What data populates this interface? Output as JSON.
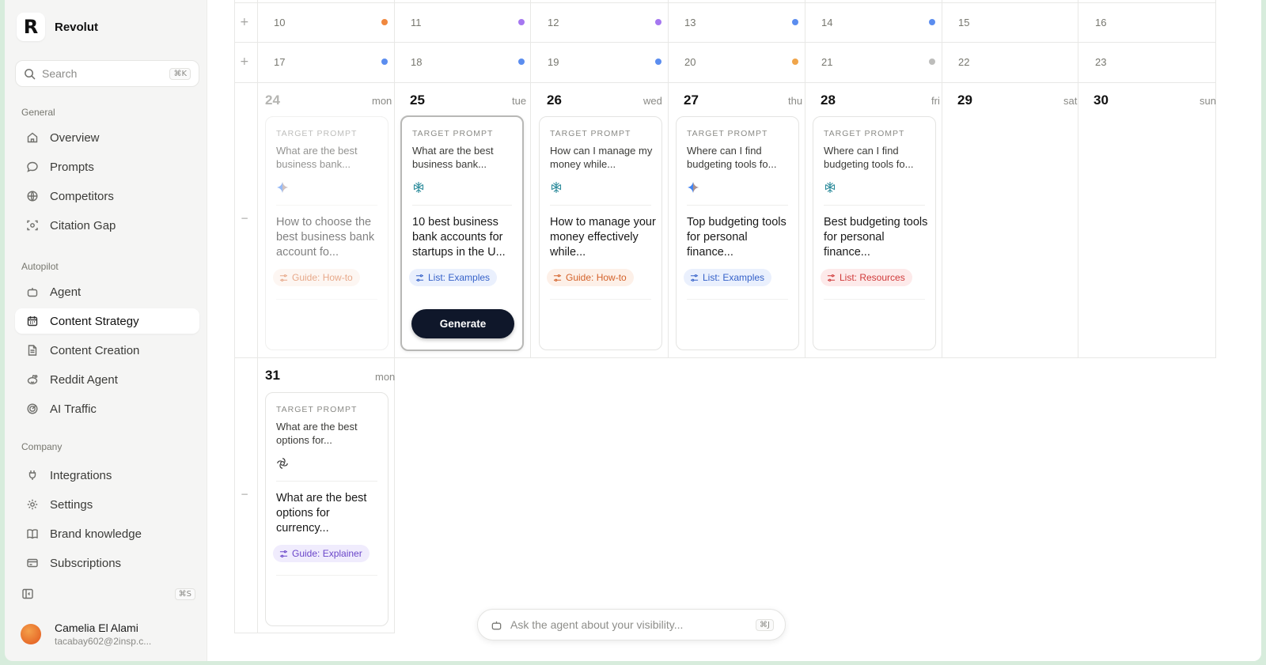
{
  "brand": {
    "logo_letter": "R",
    "name": "Revolut"
  },
  "search": {
    "placeholder": "Search",
    "shortcut": "⌘K"
  },
  "sidebar": {
    "sections": [
      {
        "label": "General",
        "items": [
          {
            "label": "Overview",
            "icon": "home-icon"
          },
          {
            "label": "Prompts",
            "icon": "chat-bubble-icon"
          },
          {
            "label": "Competitors",
            "icon": "globe-icon"
          },
          {
            "label": "Citation Gap",
            "icon": "scan-icon"
          }
        ]
      },
      {
        "label": "Autopilot",
        "items": [
          {
            "label": "Agent",
            "icon": "robot-icon"
          },
          {
            "label": "Content Strategy",
            "icon": "calendar-icon",
            "active": true
          },
          {
            "label": "Content Creation",
            "icon": "document-icon"
          },
          {
            "label": "Reddit Agent",
            "icon": "reddit-icon"
          },
          {
            "label": "AI Traffic",
            "icon": "radar-icon"
          }
        ]
      },
      {
        "label": "Company",
        "items": [
          {
            "label": "Integrations",
            "icon": "plug-icon"
          },
          {
            "label": "Settings",
            "icon": "gear-icon"
          },
          {
            "label": "Brand knowledge",
            "icon": "book-icon"
          },
          {
            "label": "Subscriptions",
            "icon": "credit-card-icon"
          }
        ]
      }
    ],
    "collapse_shortcut": "⌘S"
  },
  "user": {
    "name": "Camelia El Alami",
    "email": "tacabay602@2insp.c..."
  },
  "calendar": {
    "compact_weeks": [
      {
        "days": [
          {
            "num": "10",
            "dot": "#f0883e"
          },
          {
            "num": "11",
            "dot": "#a577f0"
          },
          {
            "num": "12",
            "dot": "#a577f0"
          },
          {
            "num": "13",
            "dot": "#5b8def"
          },
          {
            "num": "14",
            "dot": "#5b8def"
          },
          {
            "num": "15",
            "dot": null
          },
          {
            "num": "16",
            "dot": null
          }
        ]
      },
      {
        "days": [
          {
            "num": "17",
            "dot": "#5b8def"
          },
          {
            "num": "18",
            "dot": "#5b8def"
          },
          {
            "num": "19",
            "dot": "#5b8def"
          },
          {
            "num": "20",
            "dot": "#f0a54a"
          },
          {
            "num": "21",
            "dot": "#bdbdbb"
          },
          {
            "num": "22",
            "dot": null
          },
          {
            "num": "23",
            "dot": null
          }
        ]
      }
    ],
    "week3": [
      {
        "num": "24",
        "name": "mon",
        "muted": true
      },
      {
        "num": "25",
        "name": "tue"
      },
      {
        "num": "26",
        "name": "wed"
      },
      {
        "num": "27",
        "name": "thu"
      },
      {
        "num": "28",
        "name": "fri"
      },
      {
        "num": "29",
        "name": "sat"
      },
      {
        "num": "30",
        "name": "sun"
      }
    ],
    "week4": [
      {
        "num": "31",
        "name": "mon"
      }
    ],
    "cards": [
      {
        "label": "TARGET PROMPT",
        "prompt": "What are the best business bank...",
        "engine": "gemini-icon",
        "title": "How to choose the best business bank account fo...",
        "badge": "Guide: How-to",
        "badge_type": "howto"
      },
      {
        "label": "TARGET PROMPT",
        "prompt": "What are the best business bank...",
        "engine": "perplexity-icon",
        "title": "10 best business bank accounts for startups in the U...",
        "badge": "List: Examples",
        "badge_type": "examples",
        "button": "Generate"
      },
      {
        "label": "TARGET PROMPT",
        "prompt": "How can I manage my money while...",
        "engine": "perplexity-icon",
        "title": "How to manage your money effectively while...",
        "badge": "Guide: How-to",
        "badge_type": "howto"
      },
      {
        "label": "TARGET PROMPT",
        "prompt": "Where can I find budgeting tools fo...",
        "engine": "gemini-icon",
        "title": "Top budgeting tools for personal finance...",
        "badge": "List: Examples",
        "badge_type": "examples"
      },
      {
        "label": "TARGET PROMPT",
        "prompt": "Where can I find budgeting tools fo...",
        "engine": "perplexity-icon",
        "title": "Best budgeting tools for personal finance...",
        "badge": "List: Resources",
        "badge_type": "resources"
      },
      {
        "label": "TARGET PROMPT",
        "prompt": "What are the best options for...",
        "engine": "openai-icon",
        "title": "What are the best options for currency...",
        "badge": "Guide: Explainer",
        "badge_type": "explainer"
      }
    ],
    "row_add": "+",
    "row_collapse": "−"
  },
  "agent_bar": {
    "placeholder": "Ask the agent about your visibility...",
    "shortcut": "⌘J"
  }
}
